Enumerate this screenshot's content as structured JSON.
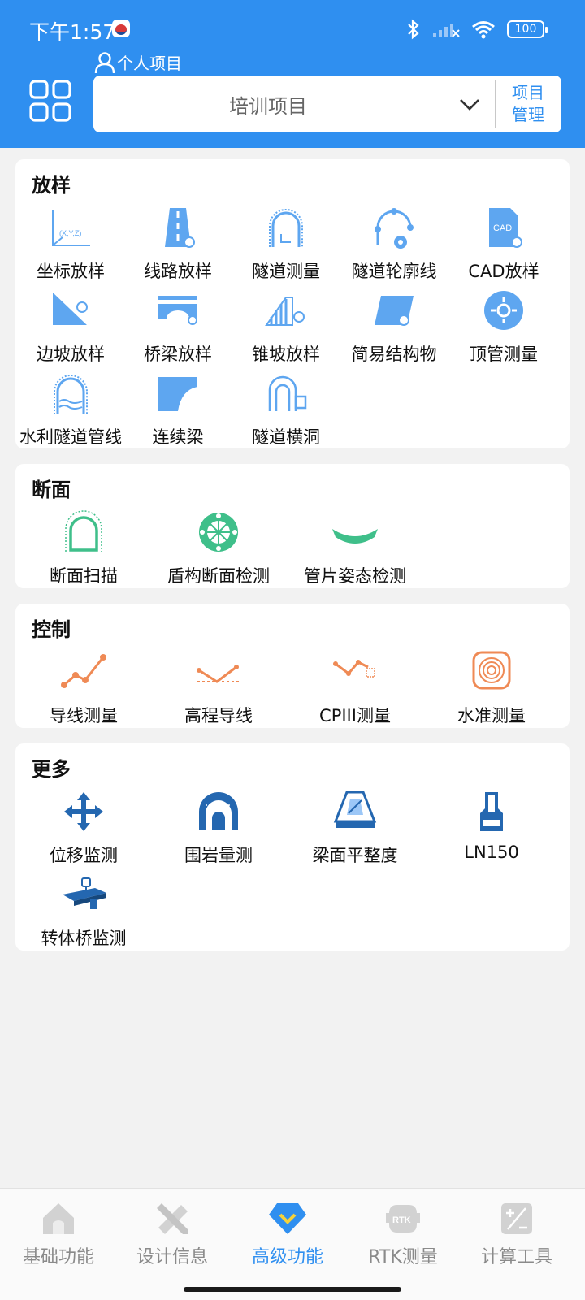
{
  "status_bar": {
    "time": "下午1:57",
    "battery": "100",
    "icons": [
      "bluetooth-icon",
      "signal-icon",
      "wifi-icon",
      "battery-icon"
    ]
  },
  "header": {
    "personal_label": "个人项目",
    "project_name": "培训项目",
    "manage_label": "项目\n管理",
    "manage_line1": "项目",
    "manage_line2": "管理"
  },
  "sections": {
    "stakeout": {
      "title": "放样",
      "items": [
        {
          "label": "坐标放样",
          "icon": "coordinate-axes-icon"
        },
        {
          "label": "线路放样",
          "icon": "road-route-icon"
        },
        {
          "label": "隧道测量",
          "icon": "tunnel-measure-icon"
        },
        {
          "label": "隧道轮廓线",
          "icon": "tunnel-contour-icon"
        },
        {
          "label": "CAD放样",
          "icon": "cad-file-icon"
        },
        {
          "label": "边坡放样",
          "icon": "slope-icon"
        },
        {
          "label": "桥梁放样",
          "icon": "bridge-icon"
        },
        {
          "label": "锥坡放样",
          "icon": "cone-slope-icon"
        },
        {
          "label": "简易结构物",
          "icon": "simple-structure-icon"
        },
        {
          "label": "顶管测量",
          "icon": "pipe-jacking-icon"
        },
        {
          "label": "水利隧道管线",
          "icon": "water-tunnel-icon"
        },
        {
          "label": "连续梁",
          "icon": "continuous-beam-icon"
        },
        {
          "label": "隧道横洞",
          "icon": "tunnel-cross-hole-icon"
        }
      ]
    },
    "section": {
      "title": "断面",
      "items": [
        {
          "label": "断面扫描",
          "icon": "section-scan-icon"
        },
        {
          "label": "盾构断面检测",
          "icon": "shield-section-icon"
        },
        {
          "label": "管片姿态检测",
          "icon": "segment-attitude-icon"
        }
      ]
    },
    "control": {
      "title": "控制",
      "items": [
        {
          "label": "导线测量",
          "icon": "traverse-icon"
        },
        {
          "label": "高程导线",
          "icon": "elevation-traverse-icon"
        },
        {
          "label": "CPIII测量",
          "icon": "cpiii-icon"
        },
        {
          "label": "水准测量",
          "icon": "leveling-icon"
        }
      ]
    },
    "more": {
      "title": "更多",
      "items": [
        {
          "label": "位移监测",
          "icon": "displacement-arrows-icon"
        },
        {
          "label": "围岩量测",
          "icon": "surrounding-rock-icon"
        },
        {
          "label": "梁面平整度",
          "icon": "beam-flatness-icon"
        },
        {
          "label": "LN150",
          "icon": "ln150-device-icon"
        },
        {
          "label": "转体桥监测",
          "icon": "swivel-bridge-icon"
        }
      ]
    }
  },
  "bottom_nav": {
    "active": "高级功能",
    "items": [
      {
        "label": "基础功能",
        "icon": "home-icon"
      },
      {
        "label": "设计信息",
        "icon": "design-ruler-icon"
      },
      {
        "label": "高级功能",
        "icon": "diamond-icon"
      },
      {
        "label": "RTK测量",
        "icon": "rtk-icon"
      },
      {
        "label": "计算工具",
        "icon": "calculator-icon"
      }
    ],
    "rtk_badge": "RTK"
  },
  "colors": {
    "primary": "#2f8ff0",
    "stakeout_icon": "#5ea6f0",
    "section_icon": "#3fbf8a",
    "control_icon": "#ef8a55",
    "more_icon": "#2467b0",
    "nav_inactive": "#8a8a8a"
  }
}
